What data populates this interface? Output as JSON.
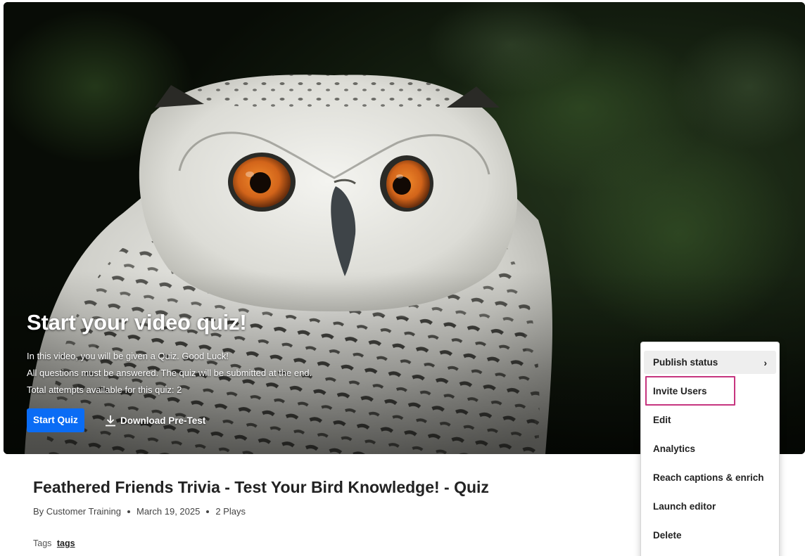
{
  "hero": {
    "title": "Start your video quiz!",
    "lines": [
      "In this video, you will be given a Quiz. Good Luck!",
      "All questions must be answered. The quiz will be submitted at the end.",
      "Total attempts available for this quiz: 2"
    ],
    "start_label": "Start Quiz",
    "download_label": "Download Pre-Test",
    "download_icon": "download-icon"
  },
  "entry": {
    "title": "Feathered Friends Trivia - Test Your Bird Knowledge! - Quiz",
    "author": "By Customer Training",
    "date": "March 19, 2025",
    "plays": "2 Plays",
    "tags_label": "Tags",
    "tag": "tags"
  },
  "menu": {
    "items": [
      {
        "label": "Publish status",
        "has_submenu": true,
        "active": true
      },
      {
        "label": "Invite Users",
        "highlighted": true
      },
      {
        "label": "Edit"
      },
      {
        "label": "Analytics"
      },
      {
        "label": "Reach captions & enrich"
      },
      {
        "label": "Launch editor"
      },
      {
        "label": "Delete"
      }
    ],
    "submenu_icon": "chevron-right-icon"
  },
  "colors": {
    "primary_button": "#0a6cf5",
    "highlight_outline": "#c6357f",
    "active_item_bg": "#eeeeee"
  }
}
